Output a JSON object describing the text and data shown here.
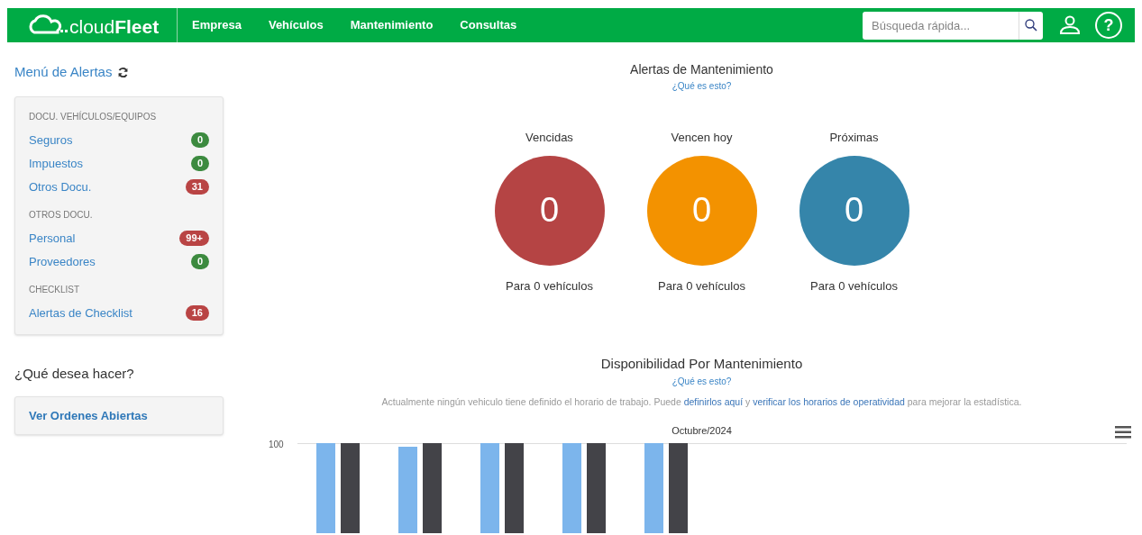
{
  "navbar": {
    "logo": {
      "light": "cloud",
      "bold": "Fleet"
    },
    "menu": [
      "Empresa",
      "Vehículos",
      "Mantenimiento",
      "Consultas"
    ],
    "search": {
      "placeholder": "Búsqueda rápida..."
    },
    "help_glyph": "?"
  },
  "sidebar": {
    "title": "Menú de Alertas",
    "sections": [
      {
        "heading": "DOCU. VEHÍCULOS/EQUIPOS",
        "items": [
          {
            "label": "Seguros",
            "count": "0",
            "color": "#3c8a3f"
          },
          {
            "label": "Impuestos",
            "count": "0",
            "color": "#3c8a3f"
          },
          {
            "label": "Otros Docu.",
            "count": "31",
            "color": "#b94444"
          }
        ]
      },
      {
        "heading": "OTROS DOCU.",
        "items": [
          {
            "label": "Personal",
            "count": "99+",
            "color": "#b94444"
          },
          {
            "label": "Proveedores",
            "count": "0",
            "color": "#3c8a3f"
          }
        ]
      },
      {
        "heading": "CHECKLIST",
        "items": [
          {
            "label": "Alertas de Checklist",
            "count": "16",
            "color": "#b94444"
          }
        ]
      }
    ],
    "actions_title": "¿Qué desea hacer?",
    "actions": [
      "Ver Ordenes Abiertas"
    ]
  },
  "alerts": {
    "title": "Alertas de Mantenimiento",
    "help": "¿Qué es esto?",
    "circles": [
      {
        "label": "Vencidas",
        "value": "0",
        "caption": "Para 0 vehículos",
        "color": "#b54444"
      },
      {
        "label": "Vencen hoy",
        "value": "0",
        "caption": "Para 0 vehículos",
        "color": "#f39200"
      },
      {
        "label": "Próximas",
        "value": "0",
        "caption": "Para 0 vehículos",
        "color": "#3585aa"
      }
    ]
  },
  "availability": {
    "title": "Disponibilidad Por Mantenimiento",
    "help": "¿Qué es esto?",
    "note": [
      {
        "kind": "text",
        "text": "Actualmente ningún vehiculo tiene definido el horario de trabajo. Puede"
      },
      {
        "kind": "link",
        "text": "definirlos aquí"
      },
      {
        "kind": "text",
        "text": "y"
      },
      {
        "kind": "link",
        "text": "verificar los horarios de operatividad"
      },
      {
        "kind": "text",
        "text": "para mejorar la estadística."
      }
    ],
    "chart": {
      "title": "Octubre/2024",
      "ytick": "100"
    }
  }
}
